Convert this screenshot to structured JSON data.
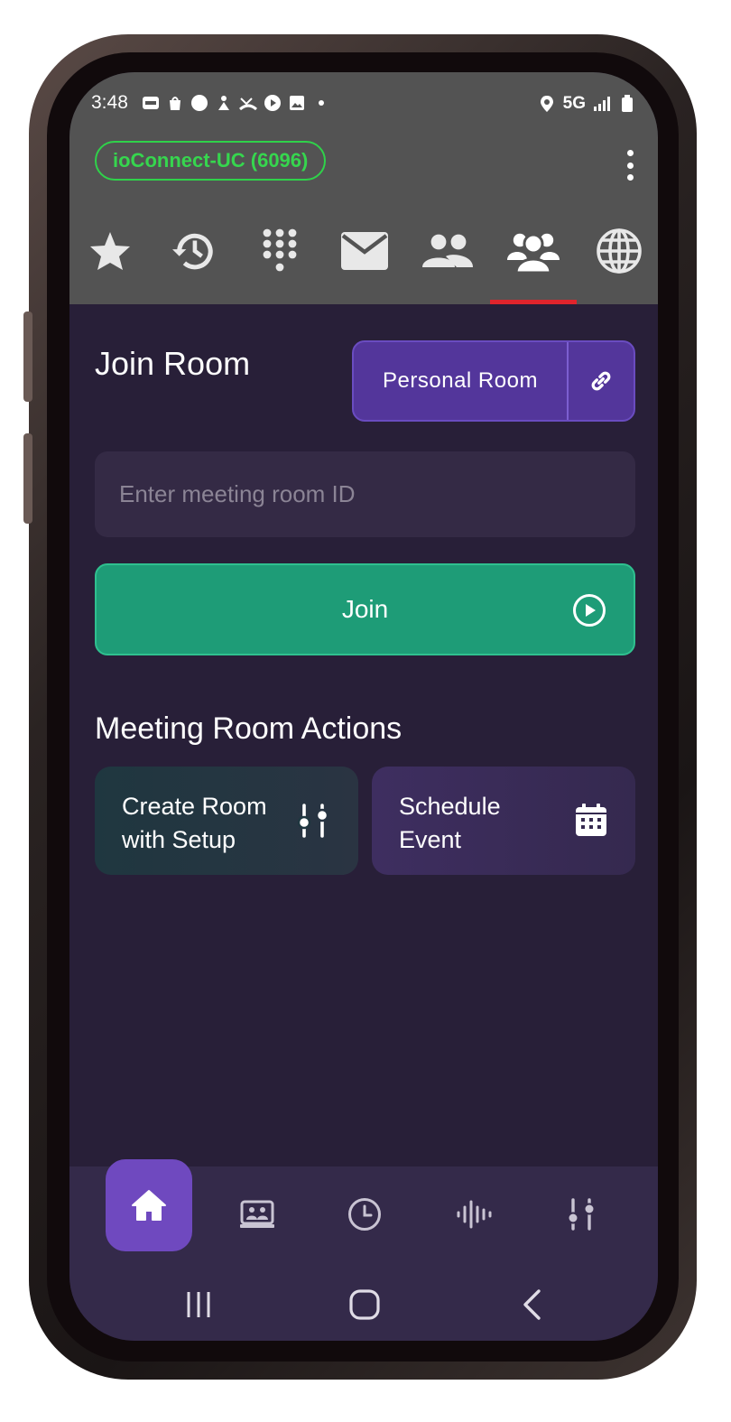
{
  "status_bar": {
    "time": "3:48",
    "network": "5G"
  },
  "account": {
    "label": "ioConnect-UC (6096)"
  },
  "nav_tabs": [
    {
      "icon": "star-icon"
    },
    {
      "icon": "history-icon"
    },
    {
      "icon": "dialpad-icon"
    },
    {
      "icon": "mail-icon"
    },
    {
      "icon": "contacts-icon"
    },
    {
      "icon": "group-icon",
      "active": true
    },
    {
      "icon": "globe-icon"
    }
  ],
  "join_room": {
    "title": "Join Room",
    "personal_room_label": "Personal Room",
    "input_placeholder": "Enter meeting room ID",
    "input_value": "",
    "join_label": "Join"
  },
  "actions": {
    "title": "Meeting Room Actions",
    "create_line1": "Create Room",
    "create_line2": "with Setup",
    "schedule_line1": "Schedule",
    "schedule_line2": "Event"
  },
  "colors": {
    "header_bg": "#535353",
    "content_bg": "#281f38",
    "accent_purple": "#53369b",
    "join_green": "#1e9c77",
    "account_green": "#36d64e",
    "active_indicator": "#e0242c"
  }
}
